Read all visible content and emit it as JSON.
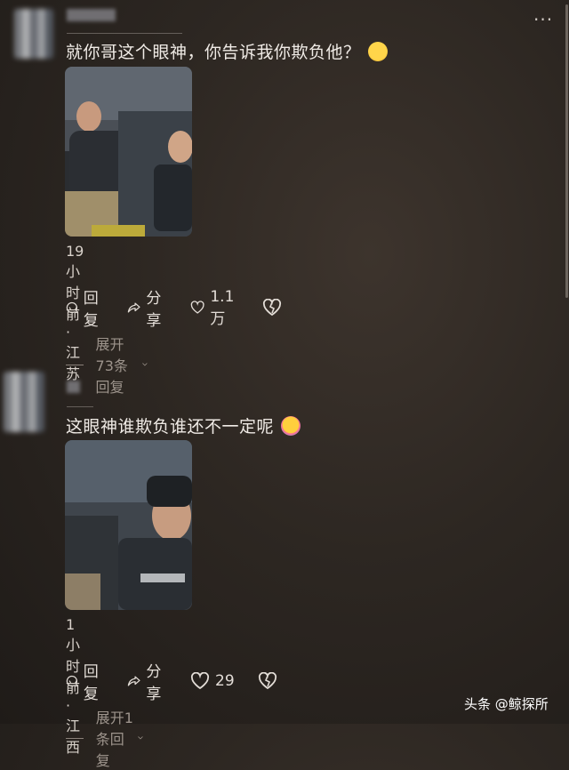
{
  "menu": {
    "icon": "more-dots-icon",
    "label": "···"
  },
  "comments": [
    {
      "text": "就你哥这个眼神，你告诉我你欺负他？",
      "emoji": "grinning-sweat-emoji",
      "meta": "19小时前 · 江苏",
      "actions": {
        "reply": "回复",
        "share": "分享",
        "likes": "1.1万"
      },
      "expand": "展开73条回复"
    },
    {
      "text": "这眼神谁欺负谁还不一定呢",
      "emoji": "face-holding-back-tears-emoji",
      "meta": "1小时前 · 江西",
      "actions": {
        "reply": "回复",
        "share": "分享",
        "likes": "29"
      },
      "expand": "展开1条回复"
    }
  ],
  "watermark": "头条 @鲸探所"
}
